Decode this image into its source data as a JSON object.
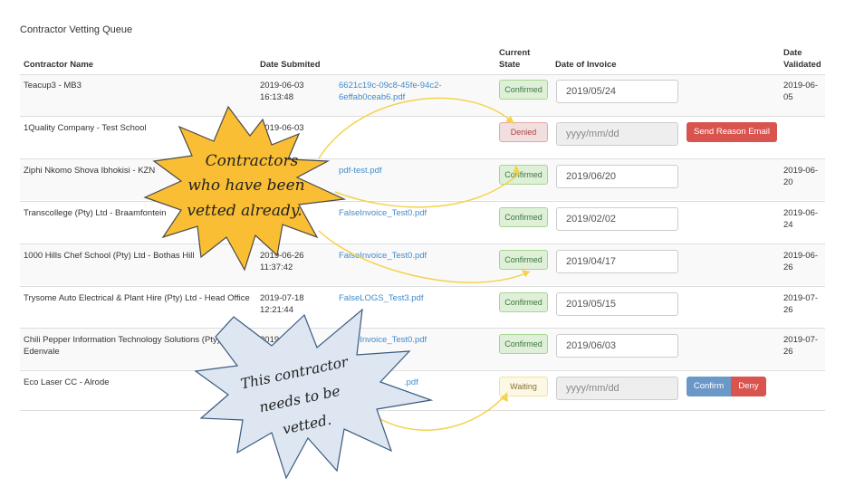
{
  "page": {
    "title": "Contractor Vetting Queue"
  },
  "columns": {
    "name": "Contractor Name",
    "submitted": "Date Submited",
    "state_line1": "Current",
    "state_line2": "State",
    "invoice_date": "Date of Invoice",
    "validated_line1": "Date",
    "validated_line2": "Validated"
  },
  "rows": [
    {
      "name": "Teacup3 - MB3",
      "name2": "",
      "submitted": "2019-06-03",
      "submitted_time": "16:13:48",
      "file": "6621c19c-09c8-45fe-94c2-",
      "file2": "6effab0ceab6.pdf",
      "state": "Confirmed",
      "invoice": "2019/05/24",
      "validated": "2019-06-",
      "validated2": "05"
    },
    {
      "name": "1Quality Company - Test School",
      "name2": "",
      "submitted": "2019-06-03",
      "submitted_time": "",
      "file": "",
      "file2": "",
      "state": "Denied",
      "invoice_placeholder": "yyyy/mm/dd",
      "action": "Send Reason Email"
    },
    {
      "name": "Ziphi Nkomo Shova Ibhokisi - KZN",
      "name2": "",
      "submitted": "",
      "submitted_time": "",
      "file": "pdf-test.pdf",
      "file2": "",
      "state": "Confirmed",
      "invoice": "2019/06/20",
      "validated": "2019-06-",
      "validated2": "20"
    },
    {
      "name": "Transcollege (Pty) Ltd - Braamfontein",
      "name2": "",
      "submitted": "",
      "submitted_time": "",
      "file": "FalseInvoice_Test0.pdf",
      "file2": "",
      "state": "Confirmed",
      "invoice": "2019/02/02",
      "validated": "2019-06-",
      "validated2": "24"
    },
    {
      "name": "1000 Hills Chef School (Pty) Ltd - Bothas Hill",
      "name2": "",
      "submitted": "2019-06-26",
      "submitted_time": "11:37:42",
      "file": "FalseInvoice_Test0.pdf",
      "file2": "",
      "state": "Confirmed",
      "invoice": "2019/04/17",
      "validated": "2019-06-",
      "validated2": "26"
    },
    {
      "name": "Trysome Auto Electrical & Plant Hire (Pty) Ltd - Head Office",
      "name2": "",
      "submitted": "2019-07-18",
      "submitted_time": "12:21:44",
      "file": "FalseLOGS_Test3.pdf",
      "file2": "",
      "state": "Confirmed",
      "invoice": "2019/05/15",
      "validated": "2019-07-",
      "validated2": "26"
    },
    {
      "name": "Chili Pepper Information Technology Solutions (Pty) Ltd -",
      "name2": "Edenvale",
      "submitted": "2019-07-2",
      "submitted_time": "",
      "file": "FalseInvoice_Test0.pdf",
      "file2": "",
      "state": "Confirmed",
      "invoice": "2019/06/03",
      "validated": "2019-07-",
      "validated2": "26"
    },
    {
      "name": "Eco Laser CC - Alrode",
      "name2": "",
      "submitted": "",
      "submitted_time": "",
      "file": ".pdf",
      "file2": "",
      "state": "Waiting",
      "invoice_placeholder": "yyyy/mm/dd",
      "confirm": "Confirm",
      "deny": "Deny"
    }
  ],
  "callouts": {
    "vetted": [
      "Contractors",
      "who have been",
      "vetted already."
    ],
    "needs": [
      "This contractor",
      "needs to be",
      "vetted."
    ]
  },
  "colors": {
    "star_fill": "#f9be34",
    "star_stroke": "#4a4a4a",
    "burst_fill": "#dde6f1",
    "burst_stroke": "#3a5a80",
    "arrow": "#f5d24b"
  }
}
